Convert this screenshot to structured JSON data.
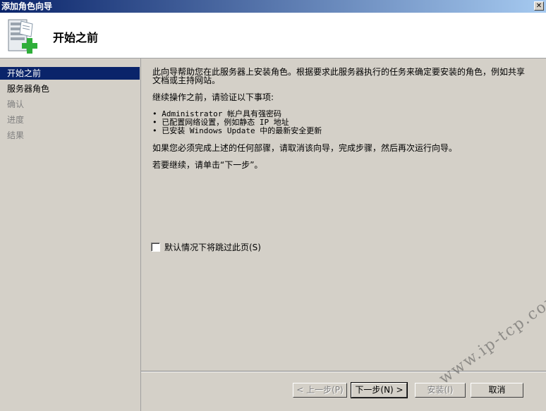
{
  "window": {
    "title": "添加角色向导",
    "close_glyph": "✕"
  },
  "header": {
    "title": "开始之前",
    "icon": "server-add-icon"
  },
  "sidebar": {
    "items": [
      {
        "label": "开始之前",
        "state": "active"
      },
      {
        "label": "服务器角色",
        "state": "enabled"
      },
      {
        "label": "确认",
        "state": "disabled"
      },
      {
        "label": "进度",
        "state": "disabled"
      },
      {
        "label": "结果",
        "state": "disabled"
      }
    ]
  },
  "content": {
    "intro_line1": "此向导帮助您在此服务器上安装角色。根据要求此服务器执行的任务来确定要安装的角色，例如共享",
    "intro_line2": "文档或主持网站。",
    "verify_heading": "继续操作之前，请验证以下事项:",
    "bullets": [
      "• Administrator 帐户具有强密码",
      "• 已配置网络设置，例如静态 IP 地址",
      "• 已安装 Windows Update 中的最新安全更新"
    ],
    "if_incomplete": "如果您必须完成上述的任何部骤，请取消该向导，完成步骤，然后再次运行向导。",
    "continue_text": "若要继续，请单击“下一步”。"
  },
  "skip_page": {
    "label": "默认情况下将跳过此页(S)",
    "checked": false
  },
  "buttons": {
    "back": "< 上一步(P)",
    "next": "下一步(N) >",
    "install": "安装(I)",
    "cancel": "取消"
  },
  "watermark": {
    "text": "www.ip-tcp.com"
  },
  "colors": {
    "titlebar": "#0a246a",
    "active_item": "#0a246a",
    "face": "#d4d0c8"
  }
}
